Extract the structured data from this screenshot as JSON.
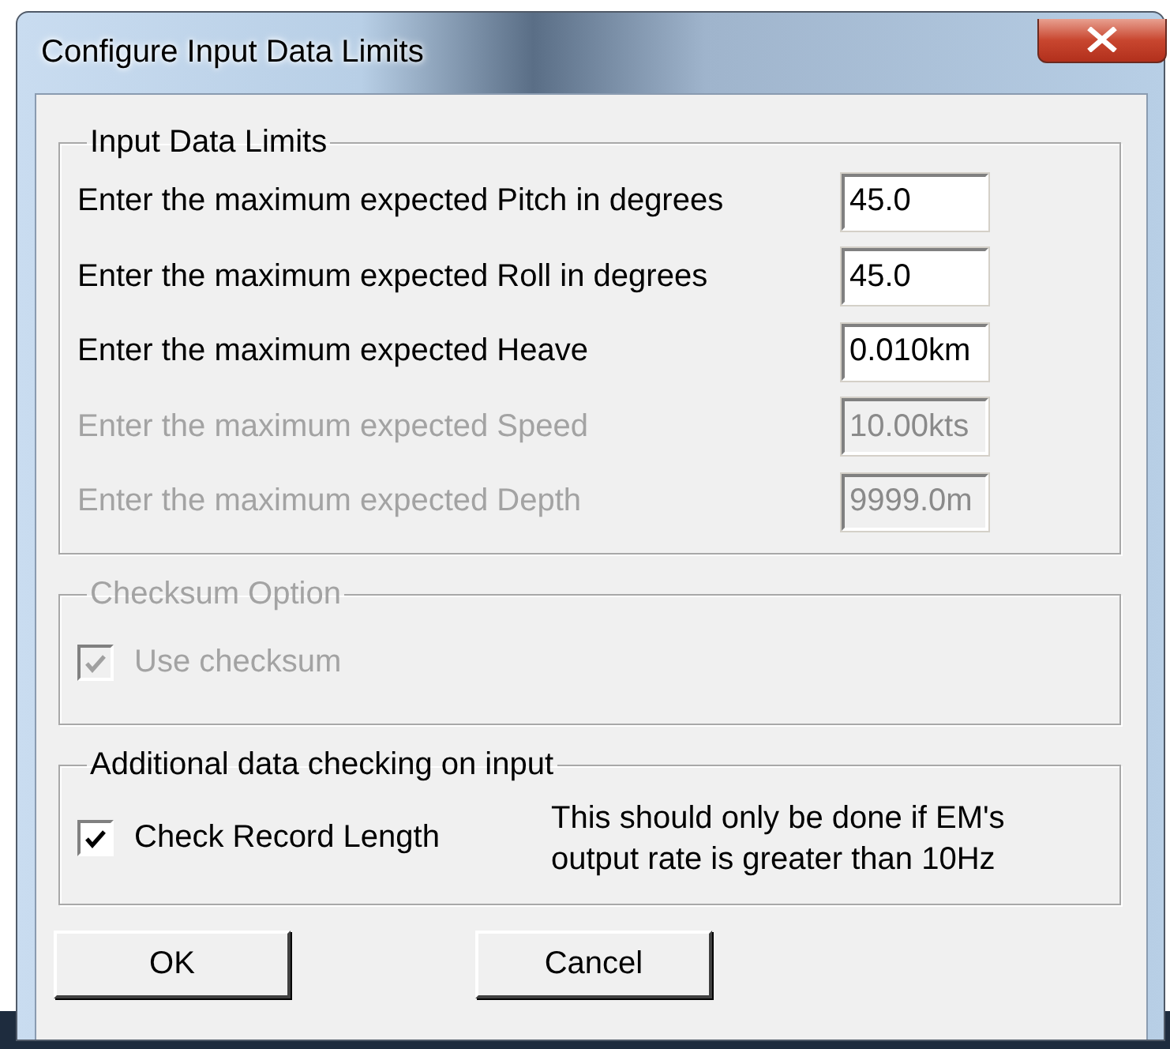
{
  "window": {
    "title": "Configure Input Data Limits"
  },
  "groups": [
    {
      "title": "Input Data Limits",
      "disabled": false,
      "kind": "fields",
      "fields": [
        {
          "label": "Enter the maximum expected Pitch in degrees",
          "value": "45.0",
          "disabled": false
        },
        {
          "label": "Enter the maximum expected Roll in degrees",
          "value": "45.0",
          "disabled": false
        },
        {
          "label": "Enter the maximum expected Heave",
          "value": "0.010km",
          "disabled": false
        },
        {
          "label": "Enter the maximum expected Speed",
          "value": "10.00kts",
          "disabled": true
        },
        {
          "label": "Enter the maximum expected Depth",
          "value": "9999.0m",
          "disabled": true
        }
      ]
    },
    {
      "title": "Checksum Option",
      "disabled": true,
      "kind": "checkboxes",
      "checkboxes": [
        {
          "label": "Use checksum",
          "checked": true,
          "disabled": true
        }
      ]
    },
    {
      "title": "Additional data checking on input",
      "disabled": false,
      "kind": "checkboxes",
      "checkboxes": [
        {
          "label": "Check Record Length",
          "checked": true,
          "disabled": false
        }
      ],
      "note": "This should only be done if EM's output rate is greater than 10Hz"
    }
  ],
  "buttons": [
    "OK",
    "Cancel"
  ]
}
